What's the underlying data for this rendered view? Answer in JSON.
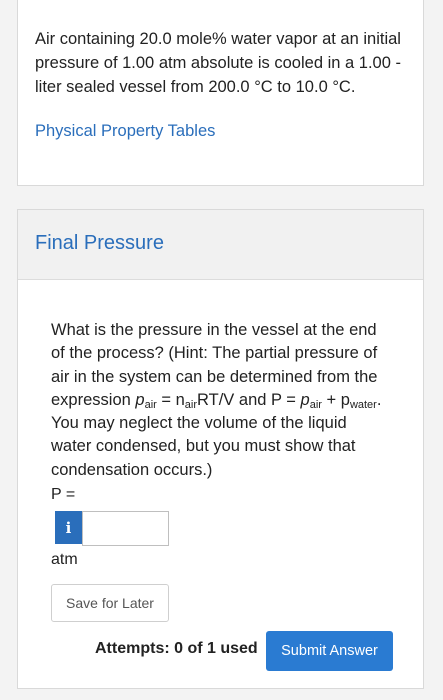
{
  "problem": {
    "text": "Air containing 20.0 mole% water vapor at an initial pressure of 1.00 atm absolute is cooled in a 1.00 -liter sealed vessel from 200.0 °C to 10.0 °C.",
    "link_label": "Physical Property Tables"
  },
  "panel": {
    "title": "Final Pressure",
    "question_part1": "What is the pressure in the vessel at the end of the process? (Hint: The partial pressure of air in the system can be determined from the expression ",
    "p": "p",
    "air": "air",
    "eq_n": " = n",
    "rtv": "RT/V and P = ",
    "plus_p": " + p",
    "water": "water",
    "question_part2": ". You may neglect the volume of the liquid water condensed, but you must show that condensation occurs.)",
    "answer_label": "P =",
    "info_icon_glyph": "i",
    "input_value": "",
    "unit": "atm",
    "save_label": "Save for Later",
    "attempts": "Attempts: 0 of 1 used",
    "submit_label": "Submit Answer"
  },
  "colors": {
    "accent": "#2a6ebb",
    "submit": "#2a7bd2"
  }
}
